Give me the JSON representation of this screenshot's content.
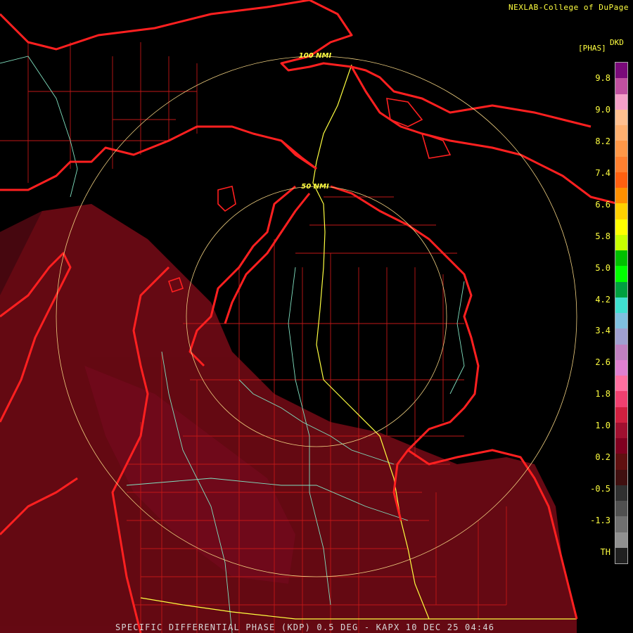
{
  "credit": "NEXLAB-College of DuPage",
  "product_line": "SPECIFIC DIFFERENTIAL PHASE (KDP) 0.5 DEG - KAPX 10 DEC 25 04:46",
  "range_rings": [
    {
      "label": "100 NMI"
    },
    {
      "label": "50 NMI"
    }
  ],
  "legend": {
    "code": "DKD",
    "unit": "[PHAS]",
    "ticks": [
      "9.8",
      "9.0",
      "8.2",
      "7.4",
      "6.6",
      "5.8",
      "5.0",
      "4.2",
      "3.4",
      "2.6",
      "1.8",
      "1.0",
      "0.2",
      "-0.5",
      "-1.3",
      "TH"
    ],
    "colors": [
      "#7a0a7a",
      "#c050a0",
      "#f4a0c8",
      "#ffc090",
      "#ffb070",
      "#ff9848",
      "#ff8030",
      "#ff6010",
      "#ff9000",
      "#ffd000",
      "#ffff00",
      "#c8ff00",
      "#00c000",
      "#00ff00",
      "#00a040",
      "#40e0d0",
      "#80c0e0",
      "#a0a0d0",
      "#c080c0",
      "#e080d0",
      "#ff70a0",
      "#f04070",
      "#d02040",
      "#a01030",
      "#800020",
      "#601010",
      "#401010",
      "#303030",
      "#505050",
      "#707070",
      "#909090",
      "#202020"
    ]
  },
  "colors": {
    "state_border": "#ff2020",
    "county_line": "#c01818",
    "highway": "#ffff40",
    "road_secondary": "#80e0c0",
    "echo": "#6a0a14",
    "range_ring": "#f0d080"
  }
}
